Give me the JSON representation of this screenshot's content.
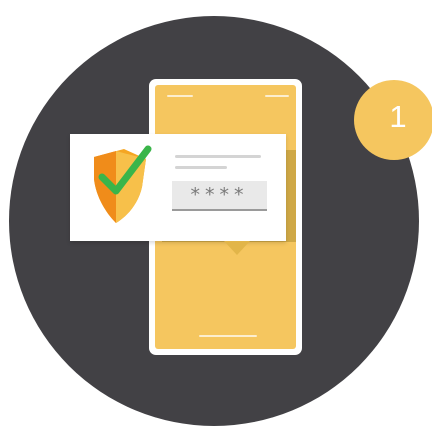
{
  "pin_field": {
    "value": "****"
  },
  "badge": {
    "number": "1"
  },
  "colors": {
    "disc": "#424145",
    "phone_screen": "#f5c65f",
    "badge": "#f5c65f",
    "check": "#3ab54a",
    "shield": "#f5a623"
  },
  "icons": [
    "shield-check-icon"
  ]
}
